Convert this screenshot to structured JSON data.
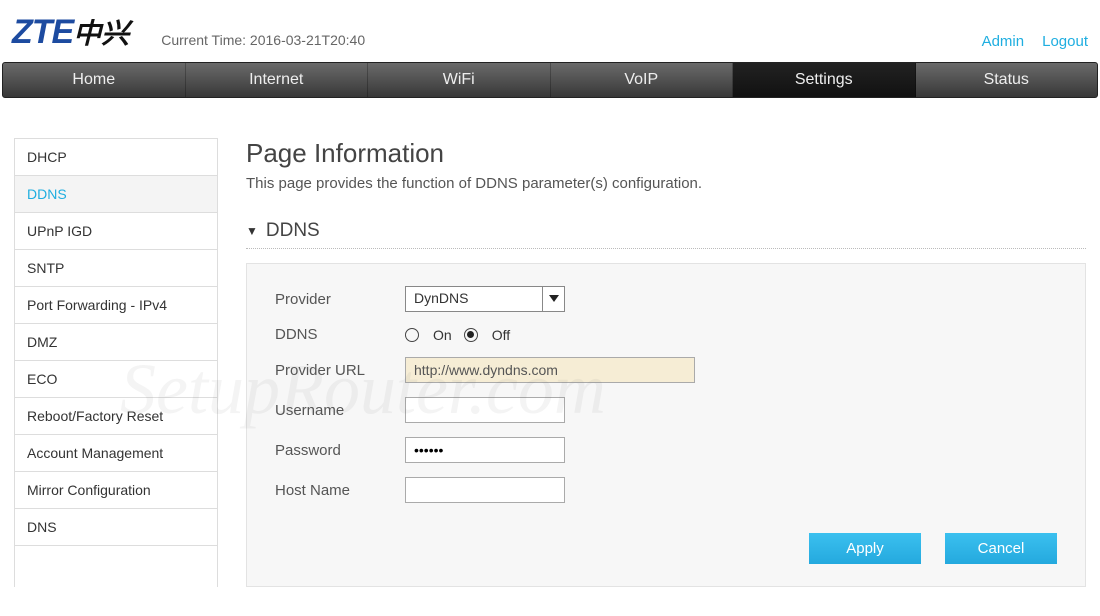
{
  "header": {
    "logo_main": "ZTE",
    "logo_cn": "中兴",
    "current_time_label": "Current Time: 2016-03-21T20:40",
    "admin_link": "Admin",
    "logout_link": "Logout"
  },
  "nav": {
    "items": [
      "Home",
      "Internet",
      "WiFi",
      "VoIP",
      "Settings",
      "Status"
    ],
    "active_index": 4
  },
  "sidebar": {
    "items": [
      "DHCP",
      "DDNS",
      "UPnP IGD",
      "SNTP",
      "Port Forwarding - IPv4",
      "DMZ",
      "ECO",
      "Reboot/Factory Reset",
      "Account Management",
      "Mirror Configuration",
      "DNS"
    ],
    "active_index": 1
  },
  "page": {
    "title": "Page Information",
    "description": "This page provides the function of DDNS parameter(s) configuration."
  },
  "section": {
    "title": "DDNS"
  },
  "form": {
    "provider_label": "Provider",
    "provider_value": "DynDNS",
    "ddns_label": "DDNS",
    "ddns_on_label": "On",
    "ddns_off_label": "Off",
    "ddns_selected": "off",
    "provider_url_label": "Provider URL",
    "provider_url_value": "http://www.dyndns.com",
    "username_label": "Username",
    "username_value": "",
    "password_label": "Password",
    "password_value": "••••••",
    "hostname_label": "Host Name",
    "hostname_value": "",
    "apply_label": "Apply",
    "cancel_label": "Cancel"
  },
  "watermark": "SetupRouter.com"
}
